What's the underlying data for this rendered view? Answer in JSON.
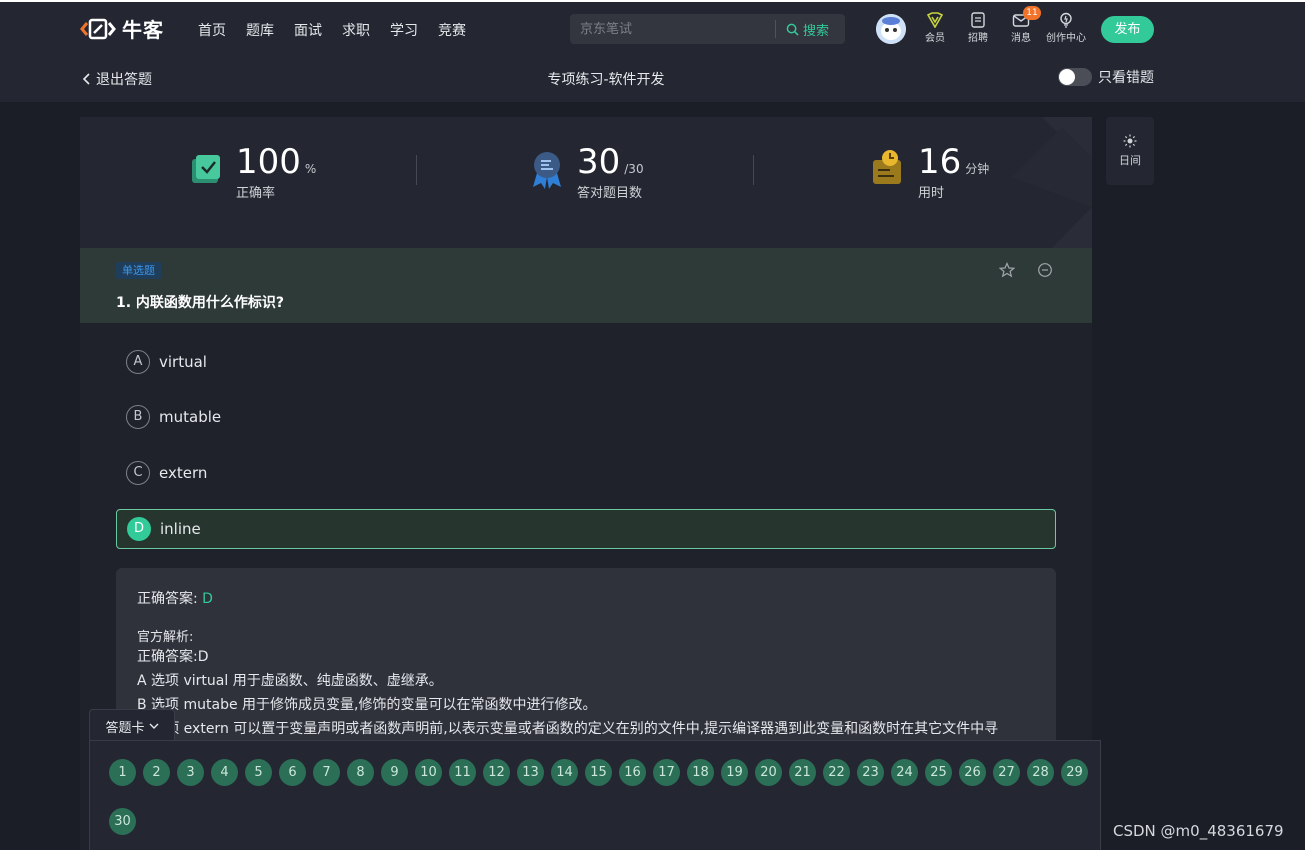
{
  "nav": {
    "logo_text": "牛客",
    "links": [
      "首页",
      "题库",
      "面试",
      "求职",
      "学习",
      "竞赛"
    ],
    "search_placeholder": "京东笔试",
    "search_button": "搜索",
    "icons": [
      {
        "label": "会员",
        "icon": "vip-icon"
      },
      {
        "label": "招聘",
        "icon": "recruit-icon"
      },
      {
        "label": "消息",
        "icon": "message-icon",
        "badge": "11"
      },
      {
        "label": "创作中心",
        "icon": "lightbulb-icon"
      }
    ],
    "publish_label": "发布"
  },
  "subheader": {
    "exit_label": "退出答题",
    "title": "专项练习-软件开发",
    "toggle_label": "只看错题",
    "toggle_on": false
  },
  "stats": [
    {
      "value": "100",
      "unit": "%",
      "label": "正确率",
      "icon": "check-book-icon"
    },
    {
      "value": "30",
      "unit": "/30",
      "label": "答对题目数",
      "icon": "medal-icon"
    },
    {
      "value": "16",
      "unit": "分钟",
      "label": "用时",
      "icon": "clock-note-icon"
    }
  ],
  "question": {
    "type": "单选题",
    "text": "1. 内联函数用什么作标识?",
    "options": [
      {
        "letter": "A",
        "text": "virtual"
      },
      {
        "letter": "B",
        "text": "mutable"
      },
      {
        "letter": "C",
        "text": "extern"
      },
      {
        "letter": "D",
        "text": "inline"
      }
    ],
    "selected": "D"
  },
  "analysis": {
    "correct_label": "正确答案:",
    "correct_value": "D",
    "official_label": "官方解析:",
    "lines": [
      "正确答案:D",
      "A 选项 virtual 用于虚函数、纯虚函数、虚继承。",
      "B 选项 mutabe 用于修饰成员变量,修饰的变量可以在常函数中进行修改。",
      "C 选项 extern 可以置于变量声明或者函数声明前,以表示变量或者函数的定义在别的文件中,提示编译器遇到此变量和函数时在其它文件中寻"
    ]
  },
  "side": {
    "day_label": "日间"
  },
  "answer_card": {
    "label": "答题卡",
    "numbers": [
      "1",
      "2",
      "3",
      "4",
      "5",
      "6",
      "7",
      "8",
      "9",
      "10",
      "11",
      "12",
      "13",
      "14",
      "15",
      "16",
      "17",
      "18",
      "19",
      "20",
      "21",
      "22",
      "23",
      "24",
      "25",
      "26",
      "27",
      "28",
      "29",
      "30"
    ]
  },
  "watermark": "CSDN @m0_48361679",
  "colors": {
    "accent": "#32ca99",
    "badge": "#f2732a",
    "selected_border": "#6ac9a1"
  }
}
